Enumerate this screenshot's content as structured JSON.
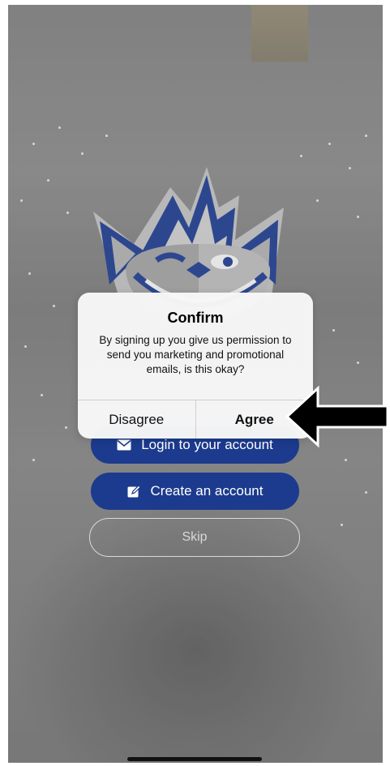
{
  "buttons": {
    "login": {
      "label": "Login to your account",
      "icon": "envelope-icon"
    },
    "create": {
      "label": "Create an account",
      "icon": "edit-icon"
    },
    "skip": {
      "label": "Skip"
    }
  },
  "dialog": {
    "title": "Confirm",
    "message": "By signing up you give us permission to send you marketing and promotional emails, is this okay?",
    "disagree_label": "Disagree",
    "agree_label": "Agree"
  },
  "colors": {
    "primary_button": "#1c3b8e",
    "mascot_blue": "#1f3f96",
    "annotation_arrow": "#000000"
  }
}
